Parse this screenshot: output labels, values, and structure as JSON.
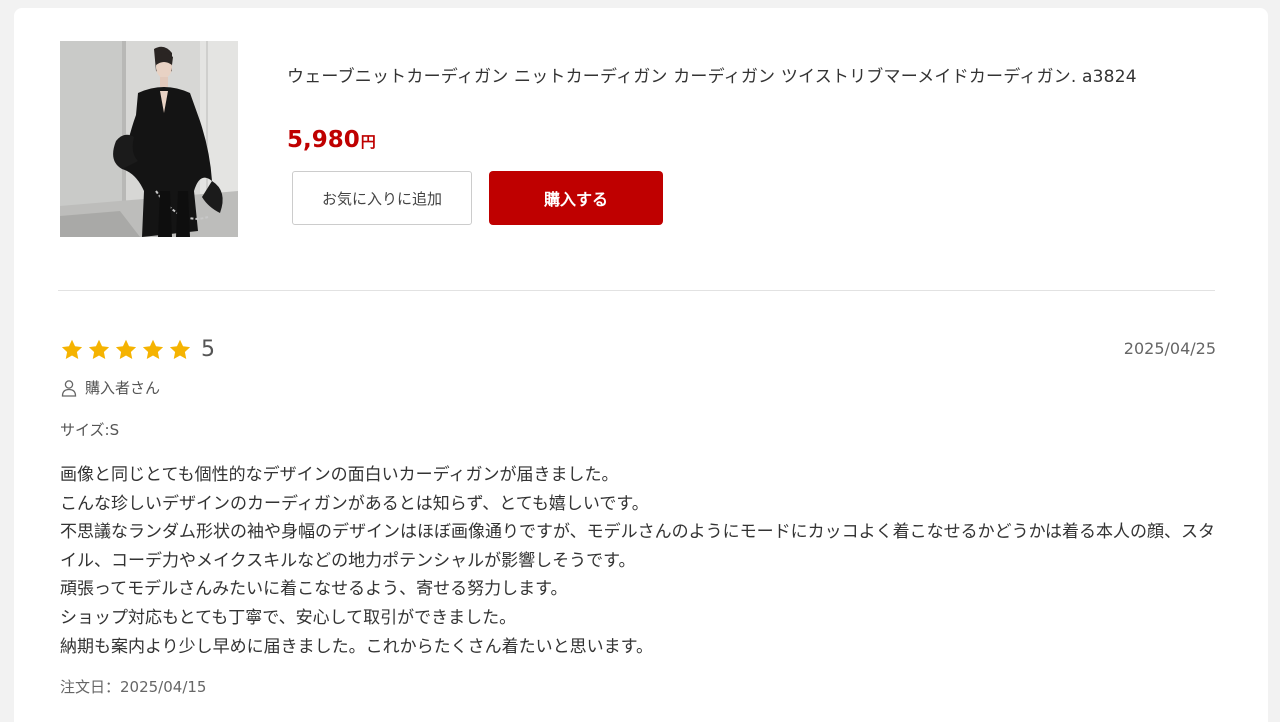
{
  "product": {
    "title": "ウェーブニットカーディガン ニットカーディガン カーディガン ツイストリブマーメイドカーディガン. a3824",
    "price": "5,980",
    "currency": "円",
    "favorite_label": "お気に入りに追加",
    "buy_label": "購入する"
  },
  "review": {
    "stars": 5,
    "rating": "5",
    "date": "2025/04/25",
    "reviewer": "購入者さん",
    "size": "サイズ:S",
    "body": "画像と同じとても個性的なデザインの面白いカーディガンが届きました。\nこんな珍しいデザインのカーディガンがあるとは知らず、とても嬉しいです。\n不思議なランダム形状の袖や身幅のデザインはほぼ画像通りですが、モデルさんのようにモードにカッコよく着こなせるかどうかは着る本人の顔、スタイル、コーデ力やメイクスキルなどの地力ポテンシャルが影響しそうです。\n頑張ってモデルさんみたいに着こなせるよう、寄せる努力します。\nショップ対応もとても丁寧で、安心して取引ができました。\n納期も案内より少し早めに届きました。これからたくさん着たいと思います。",
    "order_date": "注文日：2025/04/15"
  },
  "icons": {
    "star": "star-icon",
    "reviewer": "user-icon"
  },
  "colors": {
    "accent": "#bf0000",
    "star": "#f5b301"
  }
}
